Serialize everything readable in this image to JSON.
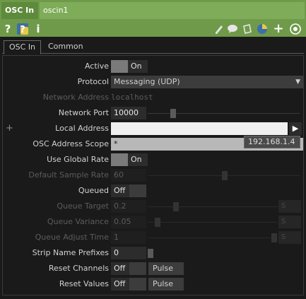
{
  "header": {
    "op_type": "OSC In",
    "op_name": "oscin1"
  },
  "toolbar": {
    "help_label": "?",
    "python_help_label": "?",
    "info_label": "i"
  },
  "tabs": [
    {
      "label": "OSC In"
    },
    {
      "label": "Common"
    }
  ],
  "params": {
    "active": {
      "label": "Active",
      "value": "On"
    },
    "protocol": {
      "label": "Protocol",
      "value": "Messaging (UDP)"
    },
    "network_address": {
      "label": "Network Address",
      "value": "localhost"
    },
    "network_port": {
      "label": "Network Port",
      "value": "10000"
    },
    "local_address": {
      "label": "Local Address",
      "value": ""
    },
    "osc_address_scope": {
      "label": "OSC Address Scope",
      "value": "*",
      "tooltip": "192.168.1.4"
    },
    "use_global_rate": {
      "label": "Use Global Rate",
      "value": "On"
    },
    "default_sample_rate": {
      "label": "Default Sample Rate",
      "value": "60"
    },
    "queued": {
      "label": "Queued",
      "value": "Off"
    },
    "queue_target": {
      "label": "Queue Target",
      "value": "0.2",
      "unit": "S"
    },
    "queue_variance": {
      "label": "Queue Variance",
      "value": "0.05",
      "unit": "S"
    },
    "queue_adjust_time": {
      "label": "Queue Adjust Time",
      "value": "1",
      "unit": "S"
    },
    "strip_name_prefixes": {
      "label": "Strip Name Prefixes",
      "value": "0"
    },
    "reset_channels": {
      "label": "Reset Channels",
      "value": "Off",
      "pulse_label": "Pulse"
    },
    "reset_values": {
      "label": "Reset Values",
      "value": "Off",
      "pulse_label": "Pulse"
    }
  },
  "colors": {
    "header_green": "#6f9a4a",
    "panel_bg": "#1a1a1a"
  }
}
